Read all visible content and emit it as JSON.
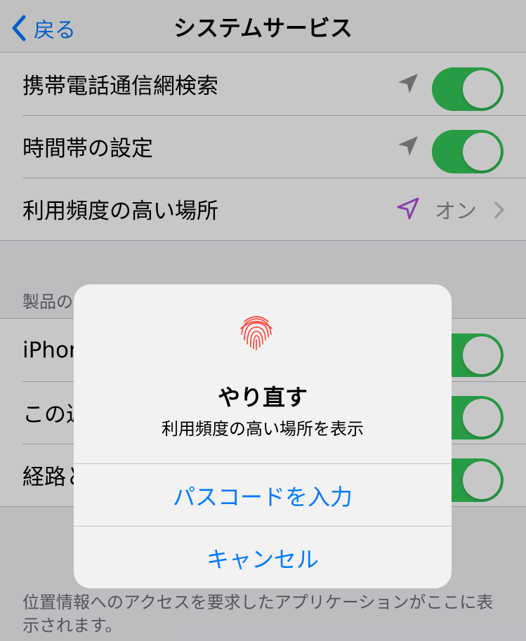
{
  "nav": {
    "back_label": "戻る",
    "title": "システムサービス"
  },
  "group1": {
    "rows": [
      {
        "label": "携帯電話通信網検索"
      },
      {
        "label": "時間帯の設定"
      },
      {
        "label": "利用頻度の高い場所",
        "value": "オン"
      }
    ]
  },
  "group2": {
    "header": "製品の",
    "rows": [
      {
        "label": "iPhon"
      },
      {
        "label": "この近"
      },
      {
        "label": "経路と"
      }
    ]
  },
  "footer": "位置情報へのアクセスを要求したアプリケーションがここに表示されます。",
  "alert": {
    "title": "やり直す",
    "message": "利用頻度の高い場所を表示",
    "buttons": {
      "passcode": "パスコードを入力",
      "cancel": "キャンセル"
    }
  },
  "colors": {
    "accent": "#007aff",
    "toggle_on": "#34c759",
    "location_icon_gray": "#8e8e93",
    "location_icon_purple": "#af52de",
    "fingerprint": "#ff3b30"
  },
  "icons": [
    "chevron-left-icon",
    "location-arrow-icon",
    "chevron-right-icon",
    "fingerprint-icon"
  ]
}
